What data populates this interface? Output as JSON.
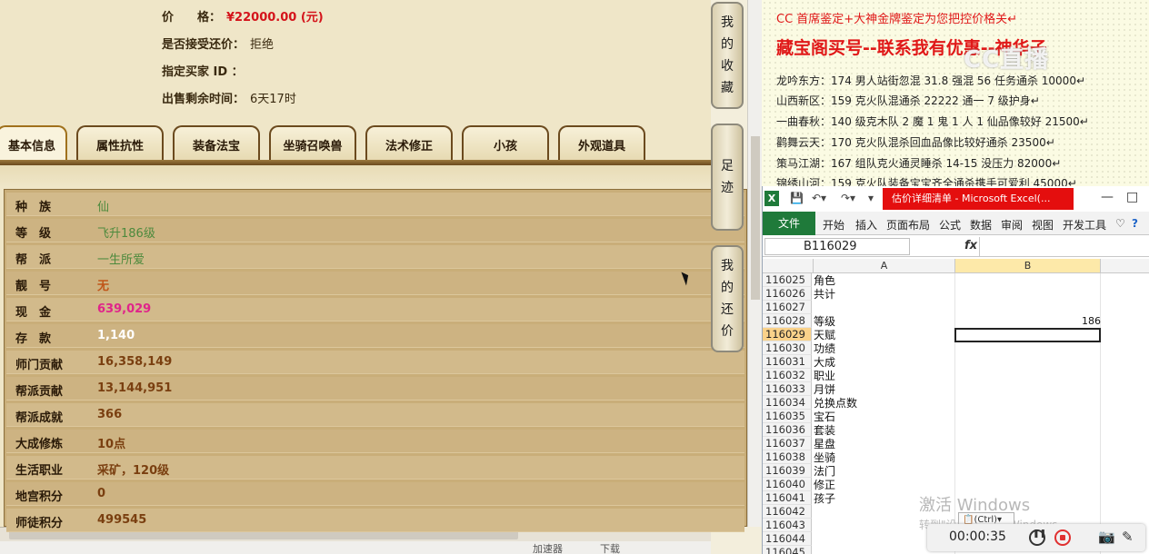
{
  "info": {
    "price_label": "价　　格：",
    "price_value": "¥22000.00 (元)",
    "counter_label": "是否接受还价：",
    "counter_value": "拒绝",
    "buyer_label": "指定买家 ID ：",
    "buyer_value": "",
    "remain_label": "出售剩余时间：",
    "remain_value": "6天17时"
  },
  "tabs": [
    "基本信息",
    "属性抗性",
    "装备法宝",
    "坐骑召唤兽",
    "法术修正",
    "小孩",
    "外观道具"
  ],
  "rows": [
    {
      "k": "种　族",
      "v": "仙",
      "c": "green"
    },
    {
      "k": "等　级",
      "v": "飞升186级",
      "c": "green"
    },
    {
      "k": "帮　派",
      "v": "一生所爱",
      "c": "green"
    },
    {
      "k": "靓　号",
      "v": "无",
      "c": "orange"
    },
    {
      "k": "现　金",
      "v": "639,029",
      "c": "pink"
    },
    {
      "k": "存　款",
      "v": "1,140",
      "c": "white"
    },
    {
      "k": "师门贡献",
      "v": "16,358,149",
      "c": "brown"
    },
    {
      "k": "帮派贡献",
      "v": "13,144,951",
      "c": "brown"
    },
    {
      "k": "帮派成就",
      "v": "366",
      "c": "brown"
    },
    {
      "k": "大成修炼",
      "v": "10点",
      "c": "brown"
    },
    {
      "k": "生活职业",
      "v": "采矿，120级",
      "c": "brown"
    },
    {
      "k": "地宫积分",
      "v": "0",
      "c": "brown"
    },
    {
      "k": "师徒积分",
      "v": "499545",
      "c": "brown"
    }
  ],
  "side_buttons": [
    {
      "chars": [
        "我",
        "的",
        "收",
        "藏"
      ]
    },
    {
      "chars": [
        "足",
        "迹"
      ]
    },
    {
      "chars": [
        "我",
        "的",
        "还",
        "价"
      ]
    }
  ],
  "statusbar": {
    "speed": "加速器",
    "download": "下载"
  },
  "notes": {
    "line1": "CC 首席鉴定+大神金牌鉴定为您把控价格关↵",
    "headline": "藏宝阁买号--联系我有优惠--神华子",
    "logo": "CC直播",
    "items": [
      "龙吟东方：174 男人站街忽混 31.8 强混 56 任务通杀 10000↵",
      "山西新区：159 克火队混通杀 22222 通一 7 级护身↵",
      "一曲春秋：140 级克木队 2 魔 1 鬼 1 人 1 仙品像较好 21500↵",
      "鹳舞云天：170 克火队混杀回血品像比较好通杀 23500↵",
      "策马江湖：167 组队克火通灵睡杀 14-15 没压力 82000↵",
      "锦绣山河：159 克火队装备宝宝齐全通杀携手可爱利 45000↵"
    ]
  },
  "excel": {
    "doc_title": "估价详细清单 - Microsoft Excel(...",
    "ribbon_file": "文件",
    "ribbon_tabs": [
      "开始",
      "插入",
      "页面布局",
      "公式",
      "数据",
      "审阅",
      "视图",
      "开发工具"
    ],
    "namebox": "B116029",
    "fx": "fx",
    "col_a": "A",
    "col_b": "B",
    "rows": [
      {
        "n": "116025",
        "a": "角色",
        "b": ""
      },
      {
        "n": "116026",
        "a": "共计",
        "b": ""
      },
      {
        "n": "116027",
        "a": "",
        "b": ""
      },
      {
        "n": "116028",
        "a": "等级",
        "b": "186"
      },
      {
        "n": "116029",
        "a": "天赋",
        "b": ""
      },
      {
        "n": "116030",
        "a": "功绩",
        "b": ""
      },
      {
        "n": "116031",
        "a": "大成",
        "b": ""
      },
      {
        "n": "116032",
        "a": "职业",
        "b": ""
      },
      {
        "n": "116033",
        "a": "月饼",
        "b": ""
      },
      {
        "n": "116034",
        "a": "兑换点数",
        "b": ""
      },
      {
        "n": "116035",
        "a": "宝石",
        "b": ""
      },
      {
        "n": "116036",
        "a": "套装",
        "b": ""
      },
      {
        "n": "116037",
        "a": "星盘",
        "b": ""
      },
      {
        "n": "116038",
        "a": "坐骑",
        "b": ""
      },
      {
        "n": "116039",
        "a": "法门",
        "b": ""
      },
      {
        "n": "116040",
        "a": "修正",
        "b": ""
      },
      {
        "n": "116041",
        "a": "孩子",
        "b": ""
      },
      {
        "n": "116042",
        "a": "",
        "b": ""
      },
      {
        "n": "116043",
        "a": "",
        "b": ""
      },
      {
        "n": "116044",
        "a": "",
        "b": ""
      },
      {
        "n": "116045",
        "a": "",
        "b": ""
      }
    ],
    "watermark_title": "激活 Windows",
    "watermark_sub": "转到\"设置\"以激活 Windows。",
    "paste_label": "(Ctrl)▾",
    "rec_time": "00:00:35"
  }
}
